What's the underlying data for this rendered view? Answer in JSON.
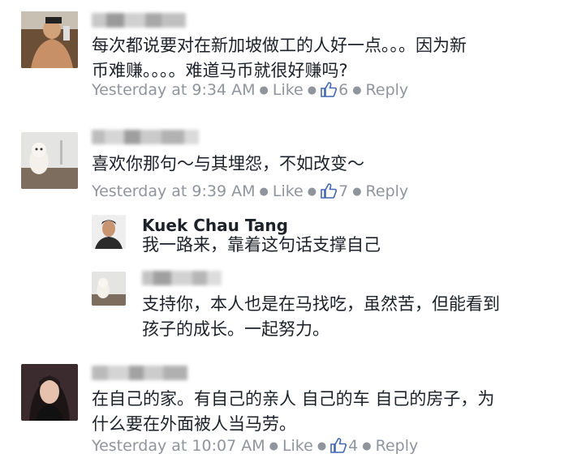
{
  "comments": [
    {
      "text": "每次都说要对在新加坡做工的人好一点。。。因为新\n币难赚。。。。难道马币就很好赚吗?",
      "time": "Yesterday at 9:34 AM",
      "like_label": "Like",
      "like_count": "6",
      "reply_label": "Reply"
    },
    {
      "text": "喜欢你那句～与其埋怨，不如改变～",
      "time": "Yesterday at 9:39 AM",
      "like_label": "Like",
      "like_count": "7",
      "reply_label": "Reply",
      "replies": [
        {
          "author": "Kuek Chau Tang",
          "text": "我一路来，靠着这句话支撑自己"
        },
        {
          "text": "支持你，本人也是在马找吃，虽然苦，但能看到\n孩子的成长。一起努力。"
        }
      ]
    },
    {
      "text": "在自己的家。有自己的亲人 自己的车 自己的房子，为\n什么要在外面被人当马劳。",
      "time": "Yesterday at 10:07 AM",
      "like_label": "Like",
      "like_count": "4",
      "reply_label": "Reply"
    }
  ],
  "colors": {
    "meta": "#90949c",
    "link_blue": "#4267b2",
    "text": "#1d2129"
  },
  "icons": {
    "like": "thumbs-up-icon",
    "separator": "middle-dot"
  }
}
